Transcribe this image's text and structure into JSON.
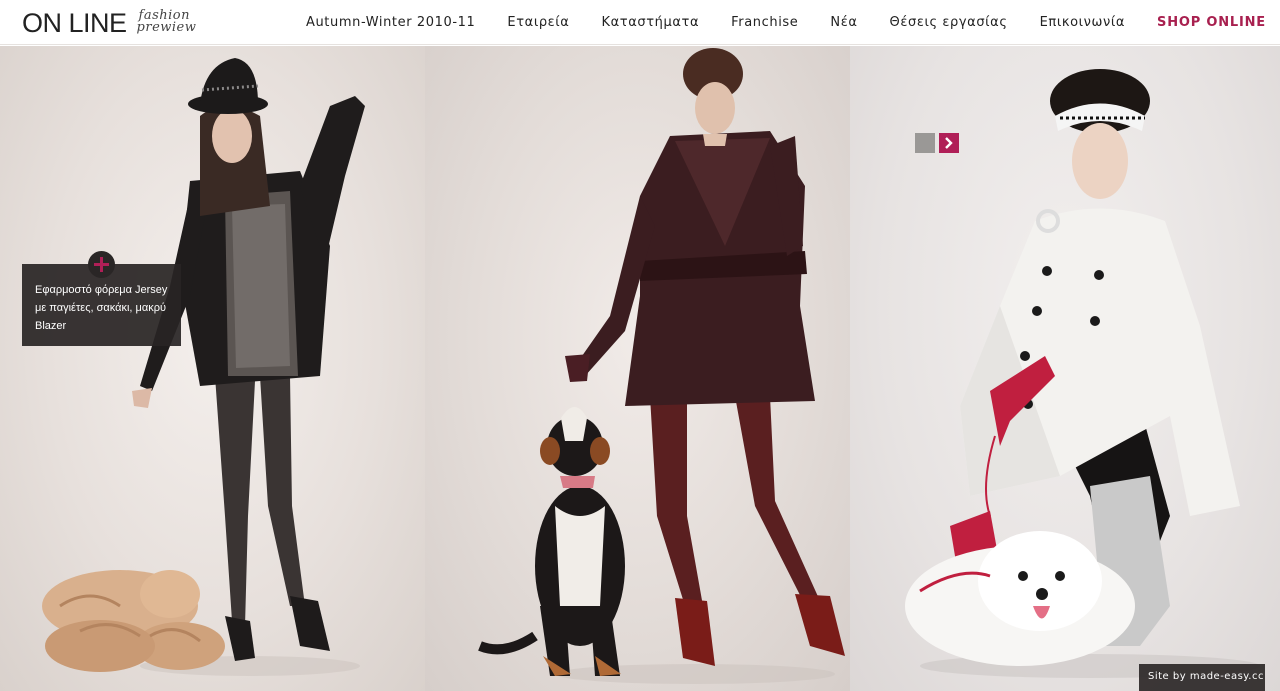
{
  "brand": {
    "logo_main": "ON LINE",
    "logo_sub_line1": "fashion",
    "logo_sub_line2": "prewiew"
  },
  "nav": {
    "items": [
      {
        "label": "Autumn-Winter 2010-11"
      },
      {
        "label": "Εταιρεία"
      },
      {
        "label": "Καταστήματα"
      },
      {
        "label": "Franchise"
      },
      {
        "label": "Νέα"
      },
      {
        "label": "Θέσεις εργασίας"
      },
      {
        "label": "Επικοινωνία"
      }
    ],
    "shop_label": "SHOP ONLINE"
  },
  "product_info": {
    "text": "Εφαρμοστό φόρεμα Jersey με παγιέτες, σακάκι, μακρύ Blazer"
  },
  "credit": {
    "text": "Site by made-easy.cc"
  },
  "colors": {
    "accent": "#a8204f",
    "tooltip_bg": "#2a2626",
    "arrow_inactive": "#9a9896",
    "arrow_active": "#b01f57"
  },
  "icons": {
    "plus": "plus-icon",
    "arrow_prev": "arrow-left-icon",
    "arrow_next": "chevron-right-icon"
  }
}
